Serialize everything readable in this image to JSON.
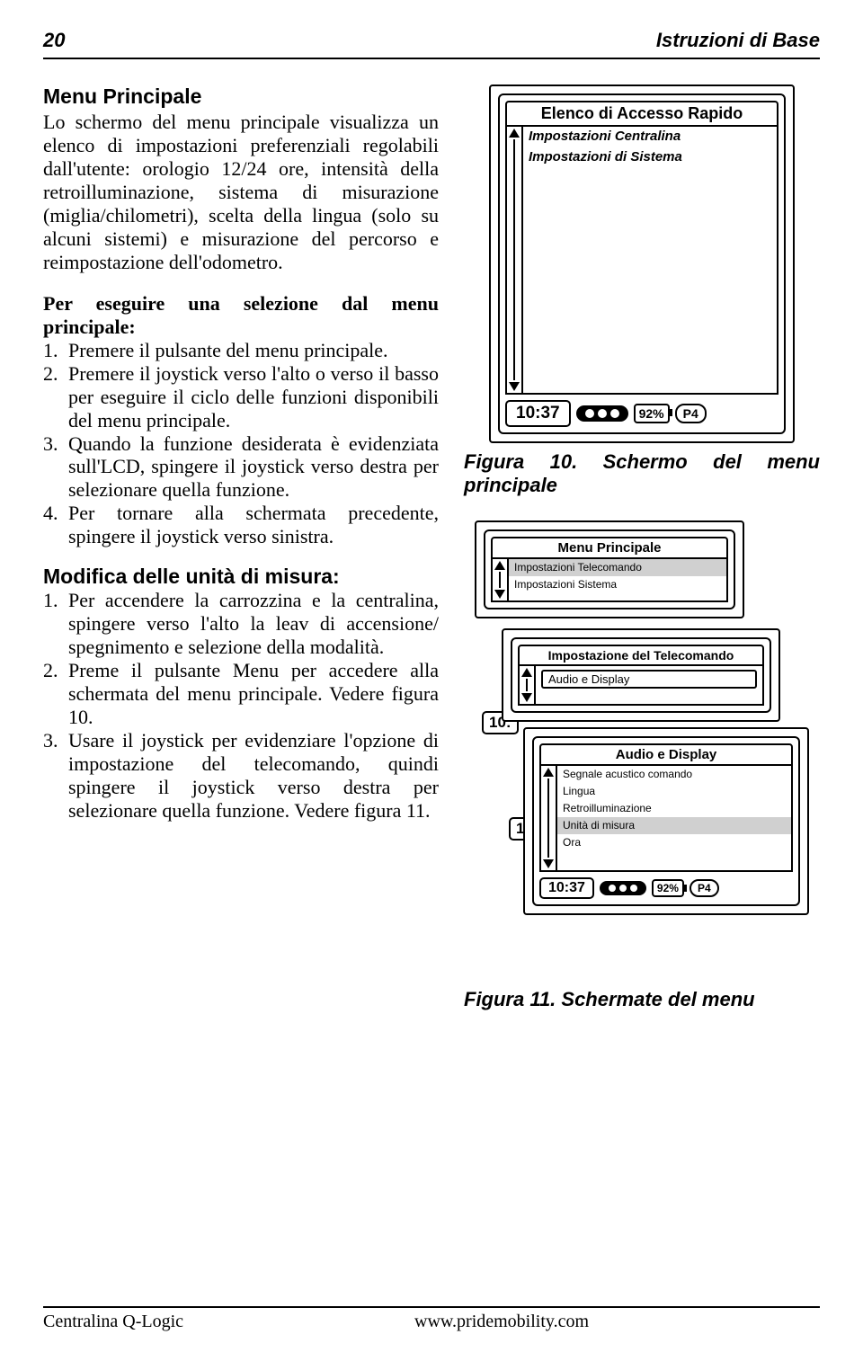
{
  "header": {
    "page": "20",
    "title": "Istruzioni di Base"
  },
  "section1": {
    "heading": "Menu Principale",
    "para": "Lo schermo del menu principale visualizza un elenco di impostazioni preferenziali regolabili dall'utente: orologio 12/24 ore, intensità della retroilluminazione, sistema di misurazione (miglia/chilometri), scelta della lingua (solo su alcuni sistemi) e misurazione del percorso e reimpostazione dell'odometro."
  },
  "steps1": {
    "heading": "Per eseguire una selezione dal menu principale:",
    "items": [
      "Premere il pulsante del menu principale.",
      "Premere il joystick verso l'alto o verso il basso per eseguire il ciclo delle funzioni disponibili del menu principale.",
      "Quando la funzione desiderata è evidenziata sull'LCD, spingere il joystick verso destra per selezionare quella funzione.",
      "Per tornare alla schermata precedente, spingere il joystick verso sinistra."
    ]
  },
  "steps2": {
    "heading": "Modifica delle unità di misura:",
    "items": [
      "Per accendere la carrozzina e la centralina, spingere verso l'alto la leav di accensione/ spegnimento e selezione della modalità.",
      "Preme il pulsante Menu per accedere alla schermata del menu principale. Vedere figura 10.",
      "Usare il joystick per evidenziare l'opzione di impostazione del telecomando, quindi spingere il joystick verso destra per selezionare quella funzione. Vedere figura 11."
    ]
  },
  "fig10": {
    "screen_title": "Elenco di Accesso Rapido",
    "row1": "Impostazioni Centralina",
    "row2": "Impostazioni di Sistema",
    "time": "10:37",
    "batt": "92%",
    "mode": "P4",
    "caption": "Figura 10. Schermo del menu principale"
  },
  "fig11": {
    "a": {
      "title": "Menu Principale",
      "row1": "Impostazioni Telecomando",
      "row2": "Impostazioni Sistema"
    },
    "b": {
      "title": "Impostazione del Telecomando",
      "row1": "Audio e Display"
    },
    "c": {
      "title": "Audio e Display",
      "r1": "Segnale acustico comando",
      "r2": "Lingua",
      "r3": "Retroilluminazione",
      "r4": "Unità di misura",
      "r5": "Ora"
    },
    "peek_time": "10:",
    "time": "10:37",
    "batt": "92%",
    "mode": "P4",
    "caption": "Figura 11. Schermate del menu"
  },
  "footer": {
    "left": "Centralina Q-Logic",
    "right": "www.pridemobility.com"
  }
}
